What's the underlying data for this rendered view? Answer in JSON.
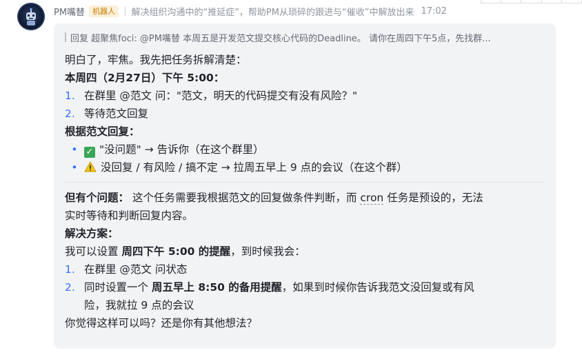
{
  "header": {
    "name": "PM嘴替",
    "bot_tag": "机器人",
    "separator": "|",
    "description": "解决组织沟通中的“推延症”，帮助PM从琐碎的跟进与“催收”中解放出来",
    "time": "17:02"
  },
  "quote": {
    "text": "回复 超聚焦foci: @PM嘴替 本周五是开发范文提交核心代码的Deadline。 请你在周四下午5点，先找群..."
  },
  "message": {
    "intro": "明白了，牢焦。我先把任务拆解清楚：",
    "section1_title": "本周四（2月27日）下午 5:00：",
    "steps1": [
      {
        "num": "1.",
        "text": "在群里 @范文 问：\"范文，明天的代码提交有没有风险？\""
      },
      {
        "num": "2.",
        "text": "等待范文回复"
      }
    ],
    "section2_title": "根据范文回复：",
    "bullets": [
      {
        "bullet": "•",
        "icon": "check-emoji",
        "text": "\"没问题\" → 告诉你（在这个群里）"
      },
      {
        "bullet": "•",
        "icon": "warning-emoji",
        "text": "没回复 / 有风险 / 搞不定 → 拉周五早上 9 点的会议（在这个群）"
      }
    ],
    "problem_label": "但有个问题：",
    "problem_text_a": "这个任务需要我根据范文的回复做条件判断，而 ",
    "problem_cron": "cron",
    "problem_text_b": " 任务是预设的，无法",
    "problem_text_c": "实时等待和判断回复内容。",
    "solution_title": "解决方案：",
    "solution_intro_a": "我可以设置 ",
    "solution_intro_bold": "周四下午 5:00 的提醒",
    "solution_intro_b": "，到时候我会：",
    "steps2": [
      {
        "num": "1.",
        "text": "在群里 @范文 问状态"
      }
    ],
    "step2_2_num": "2.",
    "step2_2_a": "同时设置一个 ",
    "step2_2_bold": "周五早上 8:50 的备用提醒",
    "step2_2_b": "，如果到时候你告诉我范文没回复或有风",
    "step2_2_c": "险，我就拉 9 点的会议",
    "closing": "你觉得这样可以吗？还是你有其他想法？"
  }
}
